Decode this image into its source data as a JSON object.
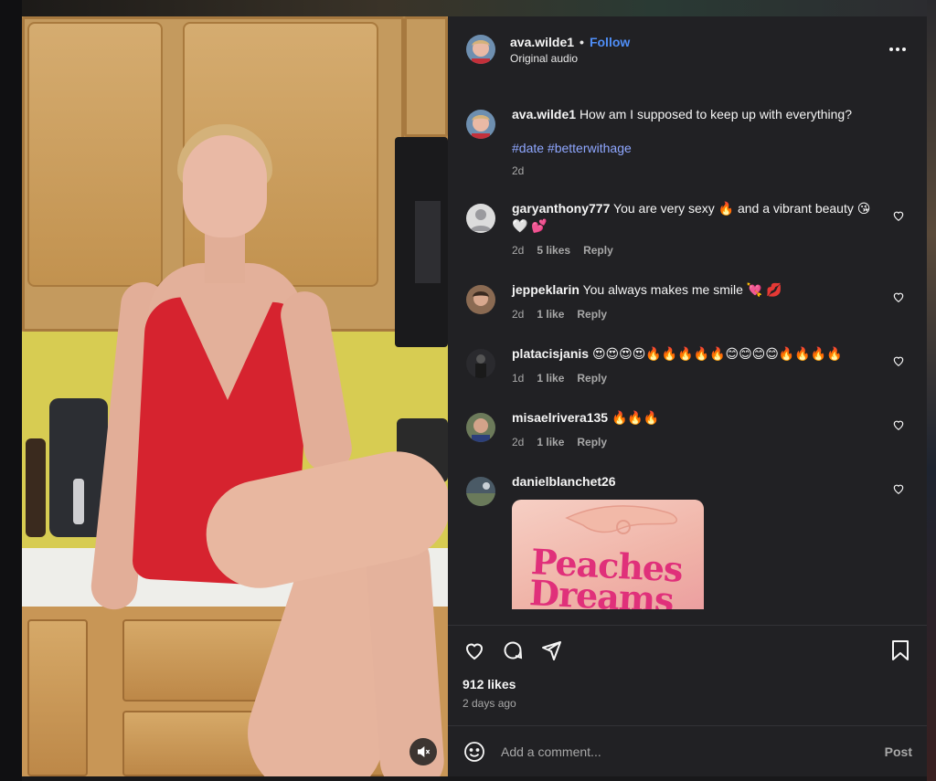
{
  "post": {
    "username": "ava.wilde1",
    "separator": "•",
    "follow_label": "Follow",
    "audio": "Original audio",
    "caption": "How am I supposed to keep up with everything?",
    "hashtags": "#date #betterwithage",
    "time": "2d"
  },
  "comments": [
    {
      "username": "garyanthony777",
      "text": "You are very sexy 🔥 and a vibrant beauty 😘 🤍 💕",
      "time": "2d",
      "likes": "5 likes",
      "reply": "Reply",
      "avatar_color": "#c8c8c8"
    },
    {
      "username": "jeppeklarin",
      "text": "You always makes me smile 💘 💋",
      "time": "2d",
      "likes": "1 like",
      "reply": "Reply",
      "avatar_color": "#7a5a44"
    },
    {
      "username": "platacisjanis",
      "text": "😍😍😍😍🔥🔥🔥🔥🔥😊😊😊😊🔥🔥🔥🔥",
      "time": "1d",
      "likes": "1 like",
      "reply": "Reply",
      "avatar_color": "#333338"
    },
    {
      "username": "misaelrivera135",
      "text": "🔥🔥🔥",
      "time": "2d",
      "likes": "1 like",
      "reply": "Reply",
      "avatar_color": "#5c6a4a"
    },
    {
      "username": "danielblanchet26",
      "text": "",
      "gif_text": "Peaches Dreams",
      "avatar_color": "#4a5a66"
    }
  ],
  "actions": {
    "likes": "912 likes",
    "time_ago": "2 days ago"
  },
  "composer": {
    "placeholder": "Add a comment...",
    "post_label": "Post"
  },
  "colors": {
    "panel_bg": "#212124",
    "link_blue": "#4f8ef7",
    "hashtag": "#8fa7ff",
    "dress_red": "#d6232f"
  }
}
